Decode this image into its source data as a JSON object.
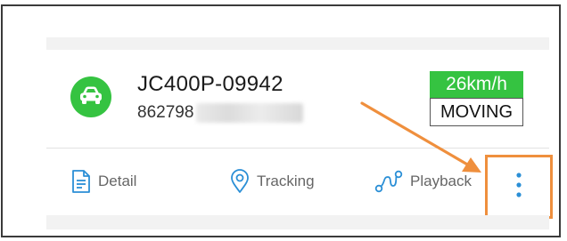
{
  "device": {
    "name": "JC400P-09942",
    "imei_visible": "862798",
    "speed": "26km/h",
    "status": "MOVING",
    "icon": "car-icon"
  },
  "actions": [
    {
      "label": "Detail",
      "icon": "document-icon"
    },
    {
      "label": "Tracking",
      "icon": "location-pin-icon"
    },
    {
      "label": "Playback",
      "icon": "route-icon"
    }
  ],
  "more_icon": "more-vertical-icon",
  "colors": {
    "green": "#35c341",
    "icon_blue": "#2b8fd6",
    "annotation_orange": "#ef8f3d"
  }
}
